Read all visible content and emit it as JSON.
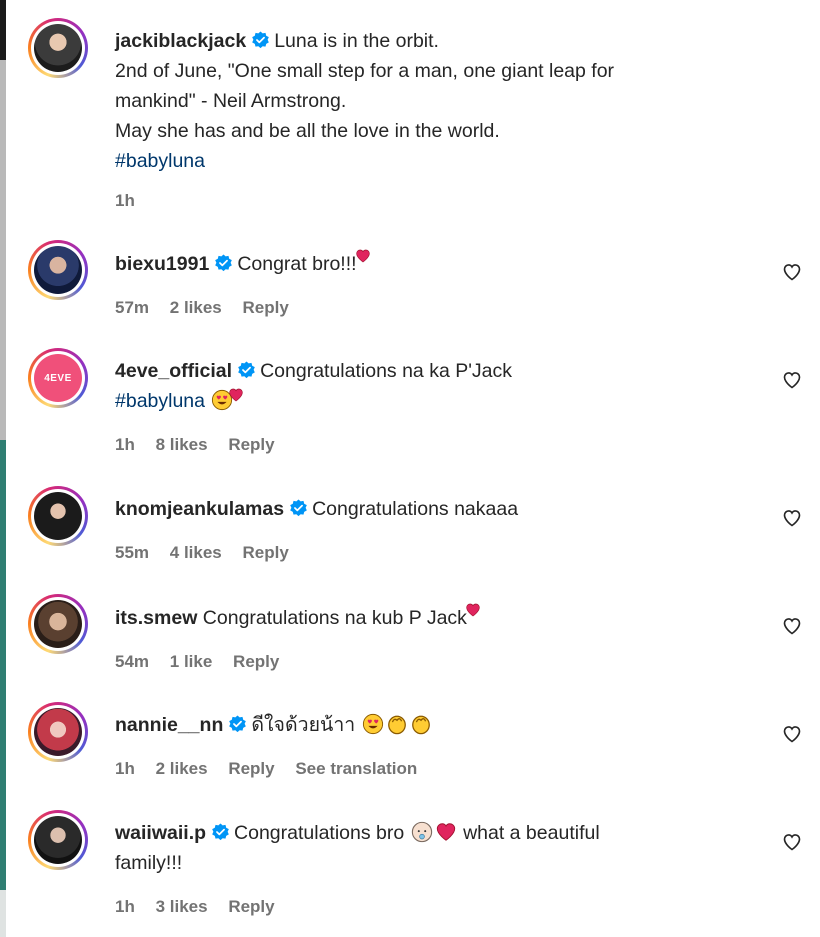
{
  "caption": {
    "username": "jackiblackjack",
    "lines": [
      "Luna is in the orbit.",
      "2nd of June, \"One small step for a man, one giant leap for",
      "mankind\" - Neil Armstrong.",
      "May she has and be all the love in the world."
    ],
    "hashtag": "#babyluna",
    "time": "1h"
  },
  "comments": [
    {
      "username": "biexu1991",
      "verified": true,
      "text": "Congrat bro!!!",
      "time": "57m",
      "likes": "2 likes",
      "reply": "Reply"
    },
    {
      "username": "4eve_official",
      "verified": true,
      "text": "Congratulations na ka P'Jack",
      "hashtag": "#babyluna",
      "time": "1h",
      "likes": "8 likes",
      "reply": "Reply",
      "avatar_label": "4EVE"
    },
    {
      "username": "knomjeankulamas",
      "verified": true,
      "text": "Congratulations nakaaa",
      "time": "55m",
      "likes": "4 likes",
      "reply": "Reply"
    },
    {
      "username": "its.smew",
      "verified": false,
      "text": "Congratulations na kub P Jack",
      "time": "54m",
      "likes": "1 like",
      "reply": "Reply"
    },
    {
      "username": "nannie__nn",
      "verified": true,
      "text": "ดีใจด้วยน้าา",
      "time": "1h",
      "likes": "2 likes",
      "reply": "Reply",
      "translate": "See translation"
    },
    {
      "username": "waiiwaii.p",
      "verified": true,
      "text_a": "Congratulations bro",
      "text_b": "what a beautiful",
      "text_c": "family!!!",
      "time": "1h",
      "likes": "3 likes",
      "reply": "Reply"
    }
  ],
  "colors": {
    "link": "#00376b",
    "meta": "#737373",
    "verified": "#0095f6",
    "emoji_heart": "#e0245e"
  },
  "icons": [
    "verified-badge-icon",
    "heart-outline-icon"
  ]
}
